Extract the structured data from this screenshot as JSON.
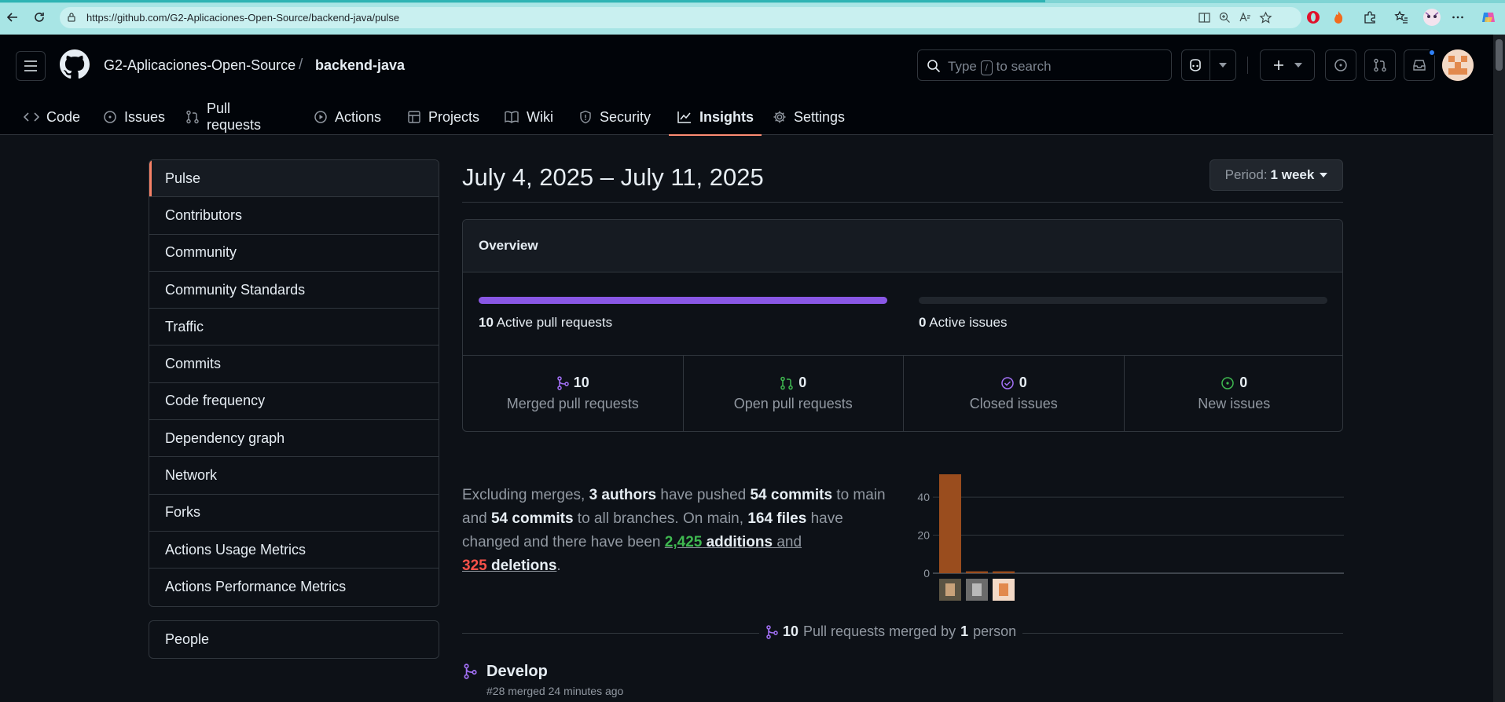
{
  "browser": {
    "url": "https://github.com/G2-Aplicaciones-Open-Source/backend-java/pulse"
  },
  "header": {
    "owner": "G2-Aplicaciones-Open-Source",
    "separator": "/",
    "repo": "backend-java",
    "search_prefix": "Type",
    "search_key": "/",
    "search_suffix": "to search"
  },
  "tabs": [
    {
      "label": "Code",
      "icon": "code-icon"
    },
    {
      "label": "Issues",
      "icon": "issue-icon"
    },
    {
      "label": "Pull requests",
      "icon": "pull-request-icon"
    },
    {
      "label": "Actions",
      "icon": "play-icon"
    },
    {
      "label": "Projects",
      "icon": "table-icon"
    },
    {
      "label": "Wiki",
      "icon": "book-icon"
    },
    {
      "label": "Security",
      "icon": "shield-icon"
    },
    {
      "label": "Insights",
      "icon": "graph-icon",
      "active": true
    },
    {
      "label": "Settings",
      "icon": "gear-icon"
    }
  ],
  "sidebar": {
    "items": [
      {
        "label": "Pulse",
        "selected": true
      },
      {
        "label": "Contributors"
      },
      {
        "label": "Community"
      },
      {
        "label": "Community Standards"
      },
      {
        "label": "Traffic"
      },
      {
        "label": "Commits"
      },
      {
        "label": "Code frequency"
      },
      {
        "label": "Dependency graph"
      },
      {
        "label": "Network"
      },
      {
        "label": "Forks"
      },
      {
        "label": "Actions Usage Metrics"
      },
      {
        "label": "Actions Performance Metrics"
      }
    ],
    "people": "People"
  },
  "main": {
    "date_range": "July 4, 2025 – July 11, 2025",
    "period_prefix": "Period:",
    "period_value": "1 week",
    "overview": {
      "title": "Overview",
      "active_prs_count": "10",
      "active_prs_label": "Active pull requests",
      "active_prs_fill": 1.0,
      "active_issues_count": "0",
      "active_issues_label": "Active issues",
      "active_issues_fill": 0.0,
      "stats": [
        {
          "count": "10",
          "label": "Merged pull requests",
          "icon": "git-merge-icon",
          "color": "#a371f7"
        },
        {
          "count": "0",
          "label": "Open pull requests",
          "icon": "git-pull-request-icon",
          "color": "#3fb950"
        },
        {
          "count": "0",
          "label": "Closed issues",
          "icon": "issue-closed-icon",
          "color": "#a371f7"
        },
        {
          "count": "0",
          "label": "New issues",
          "icon": "issue-opened-icon",
          "color": "#3fb950"
        }
      ]
    },
    "summary": {
      "t1": "Excluding merges, ",
      "authors": "3 authors",
      "t2": " have pushed ",
      "commits_main": "54 commits",
      "t3": " to main and ",
      "commits_all": "54 commits",
      "t4": " to all branches. On main, ",
      "files": "164 files",
      "t5": " have changed and there have been ",
      "additions_num": "2,425",
      "additions_word": "additions",
      "t6": " and",
      "deletions_num": "325",
      "deletions_word": "deletions",
      "t7": "."
    },
    "merged_count": "10",
    "merged_text": "Pull requests merged by",
    "merged_people": "1",
    "merged_people_word": "person",
    "pr_list": [
      {
        "title": "Develop",
        "meta": "#28 merged 24 minutes ago"
      }
    ]
  },
  "chart_data": {
    "type": "bar",
    "categories": [
      "author-1",
      "author-2",
      "author-3"
    ],
    "values": [
      52,
      1,
      1
    ],
    "yticks": [
      "0",
      "20",
      "40"
    ],
    "ylim": [
      0,
      52
    ],
    "bar_color": "#9a4d1e"
  }
}
